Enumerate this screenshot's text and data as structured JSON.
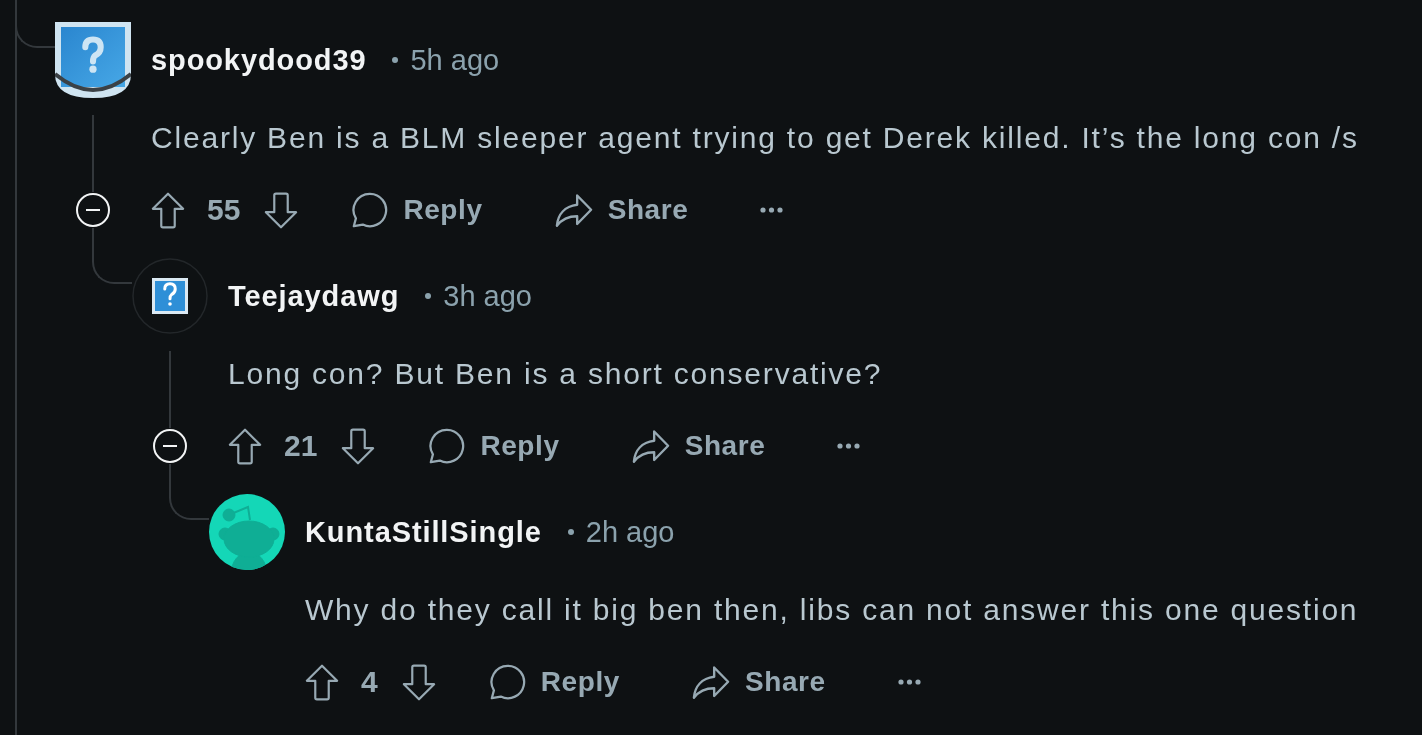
{
  "comments": [
    {
      "avatar": {
        "kind": "question-mark"
      },
      "username": "spookydood39",
      "time": "5h ago",
      "body": "Clearly Ben is a BLM sleeper agent trying to get Derek killed. It’s the long con /s",
      "votes": "55",
      "actions": [
        {
          "kind": "reply",
          "label": "Reply"
        },
        {
          "kind": "share",
          "label": "Share"
        }
      ],
      "expanded": true,
      "children": [
        {
          "avatar": {
            "kind": "question-mark-small"
          },
          "username": "Teejaydawg",
          "time": "3h ago",
          "body": "Long con? But Ben is a short conservative?",
          "votes": "21",
          "actions": [
            {
              "kind": "reply",
              "label": "Reply"
            },
            {
              "kind": "share",
              "label": "Share"
            }
          ],
          "expanded": true,
          "children": [
            {
              "avatar": {
                "kind": "character"
              },
              "username": "KuntaStillSingle",
              "time": "2h ago",
              "body": "Why do they call it big ben then, libs can not answer this one question",
              "votes": "4",
              "actions": [
                {
                  "kind": "reply",
                  "label": "Reply"
                },
                {
                  "kind": "share",
                  "label": "Share"
                }
              ]
            }
          ]
        }
      ]
    }
  ]
}
